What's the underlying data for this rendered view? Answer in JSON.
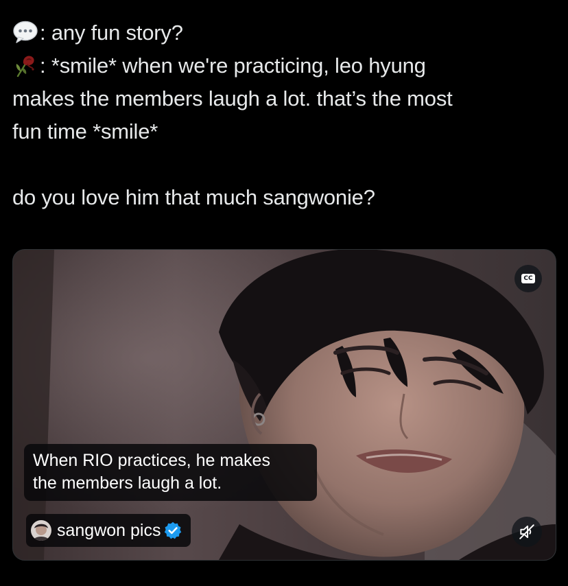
{
  "tweet": {
    "lines": [
      ": any fun story?",
      ": *smile* when we're practicing, leo hyung",
      "makes the members laugh a lot. that’s the most",
      "fun time *smile*",
      "do you love him that much sangwonie?"
    ],
    "icons": [
      "speech-bubble-icon",
      "wilted-rose-icon"
    ]
  },
  "media": {
    "caption_lines": [
      "When RIO practices, he makes",
      "the members laugh a lot."
    ],
    "source_name": "sangwon pics",
    "cc_label": "CC",
    "icons": [
      "closed-captions-icon",
      "muted-speaker-icon",
      "verified-badge-icon",
      "avatar"
    ]
  },
  "colors": {
    "background": "#000000",
    "text": "#e7e9ea",
    "verified_badge": "#1d9bf0",
    "overlay": "#08080a"
  }
}
